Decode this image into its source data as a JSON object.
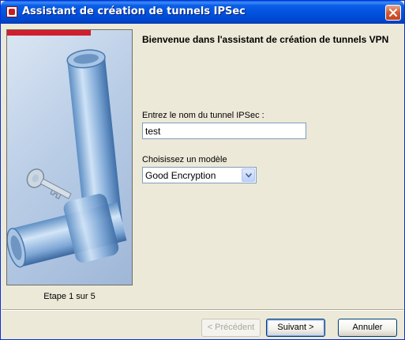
{
  "window": {
    "title": "Assistant de création de tunnels IPSec"
  },
  "wizard": {
    "heading": "Bienvenue dans l'assistant de création de tunnels VPN",
    "step_label": "Etape 1 sur 5",
    "tunnel_name_label": "Entrez le nom du tunnel IPSec :",
    "tunnel_name_value": "test",
    "template_label": "Choisissez un modèle",
    "template_selected": "Good Encryption"
  },
  "buttons": {
    "previous": "< Précédent",
    "next": "Suivant >",
    "cancel": "Annuler"
  },
  "colors": {
    "accent_bar": "#d01e2f",
    "titlebar": "#0050dd"
  }
}
